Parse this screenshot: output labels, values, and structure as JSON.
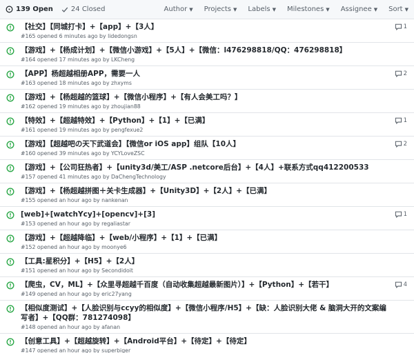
{
  "header": {
    "open_count": "139 Open",
    "closed_count": "24 Closed",
    "filters": [
      "Author",
      "Projects",
      "Labels",
      "Milestones",
      "Assignee",
      "Sort"
    ]
  },
  "colors": {
    "open_icon": "#28a745",
    "meta": "#586069",
    "border": "#e1e4e8"
  },
  "issues": [
    {
      "title": "【社交】【同城打卡】+【app】+【3人】",
      "meta": "#165 opened 6 minutes ago by lidedongsn",
      "comments": "1"
    },
    {
      "title": "【游戏】+【杨成计划】+【微信小游戏】+【5人】+【微信：l476298818/QQ：476298818】",
      "meta": "#164 opened 17 minutes ago by LKCheng",
      "comments": ""
    },
    {
      "title": "【APP】杨超越相册APP，需要一人",
      "meta": "#163 opened 18 minutes ago by zhxyms",
      "comments": "2"
    },
    {
      "title": "【游戏】+【杨超越的篮球】+【微信小程序】+【有人会美工吗？】",
      "meta": "#162 opened 19 minutes ago by zhoujian88",
      "comments": ""
    },
    {
      "title": "【特效】+【超越特效】+【Python】+【1】+【已满】",
      "meta": "#161 opened 19 minutes ago by pengfexue2",
      "comments": "1"
    },
    {
      "title": "【游戏】【超越吧の天下武道会】【微信or iOS app】组队【10人】",
      "meta": "#160 opened 39 minutes ago by YCYLoveZSC",
      "comments": "2"
    },
    {
      "title": "【游戏】+【公司狂热者】+【unity3d/美工/ASP .netcore后台】+【4人】+联系方式qq412200533",
      "meta": "#157 opened 41 minutes ago by DaChengTechnology",
      "comments": ""
    },
    {
      "title": "【游戏】+【杨超越拼图＋关卡生成器】+【Unity3D】+【2人】+【已满】",
      "meta": "#155 opened an hour ago by nankenan",
      "comments": ""
    },
    {
      "title": "[web]+[watchYcy]+[opencv]+[3]",
      "meta": "#153 opened an hour ago by regaliastar",
      "comments": "1"
    },
    {
      "title": "【游戏】+【超越降临】+【web/小程序】+【1】+【已满】",
      "meta": "#152 opened an hour ago by moonye6",
      "comments": ""
    },
    {
      "title": "【工具:星积分】+【H5】+【2人】",
      "meta": "#151 opened an hour ago by Secondidoit",
      "comments": ""
    },
    {
      "title": "【爬虫，CV，ML】+【众里寻超越千百度（自动收集超越最新图片）】+【Python】+【若干】",
      "meta": "#149 opened an hour ago by eric27yang",
      "comments": "4"
    },
    {
      "title": "【相似度测试】+【人脸识别与ccyy的相似度】+【微信小程序/H5】+【缺：人脸识别大佬 & 脑洞大开的文案编写者】+【QQ群：781274098】",
      "meta": "#148 opened an hour ago by afanan",
      "comments": ""
    },
    {
      "title": "【创意工具】+【超越旋转】+【Android平台】+【待定】+【待定】",
      "meta": "#147 opened an hour ago by superbiger",
      "comments": ""
    }
  ]
}
